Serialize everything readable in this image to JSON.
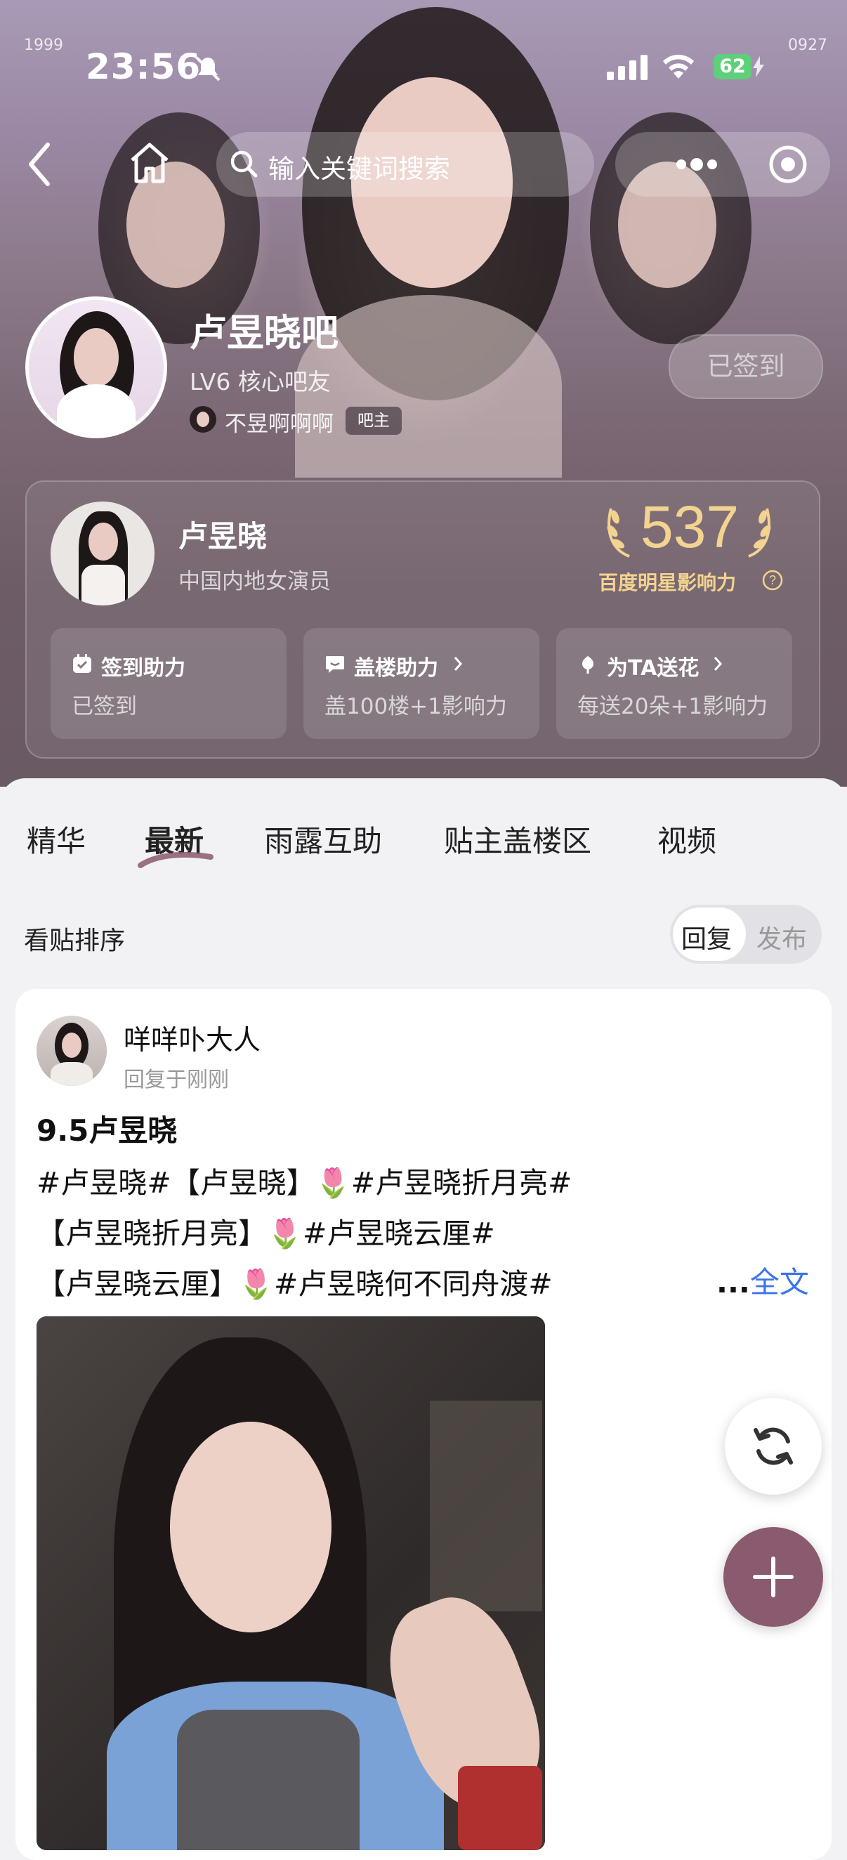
{
  "status_bar": {
    "time": "23:56",
    "battery": "62",
    "corner_left": "1999",
    "corner_right": "0927"
  },
  "nav": {
    "search_placeholder": "输入关键词搜索"
  },
  "forum": {
    "name": "卢昱晓吧",
    "level": "LV6 核心吧友",
    "owner_name": "不昱啊啊啊",
    "owner_badge": "吧主",
    "signed_label": "已签到"
  },
  "star_card": {
    "name": "卢昱晓",
    "title": "中国内地女演员",
    "score": "537",
    "score_label": "百度明星影响力",
    "actions": [
      {
        "title": "签到助力",
        "sub": "已签到"
      },
      {
        "title": "盖楼助力",
        "sub": "盖100楼+1影响力"
      },
      {
        "title": "为TA送花",
        "sub": "每送20朵+1影响力"
      }
    ]
  },
  "tabs": [
    "精华",
    "最新",
    "雨露互助",
    "贴主盖楼区",
    "视频"
  ],
  "active_tab": "最新",
  "sort": {
    "label": "看贴排序",
    "options": [
      "回复",
      "发布"
    ],
    "selected": "回复"
  },
  "post": {
    "author": "咩咩卟大人",
    "time": "回复于刚刚",
    "title": "9.5卢昱晓",
    "lines": [
      "#卢昱晓#【卢昱晓】🌷#卢昱晓折月亮#",
      "【卢昱晓折月亮】🌷#卢昱晓云厘#",
      "【卢昱晓云厘】🌷#卢昱晓何不同舟渡#"
    ],
    "ellipsis": "...",
    "more_label": "全文"
  },
  "colors": {
    "accent_link": "#3b74e8",
    "score_gold": "#f3d390",
    "fab_add": "#8a5a6e"
  }
}
